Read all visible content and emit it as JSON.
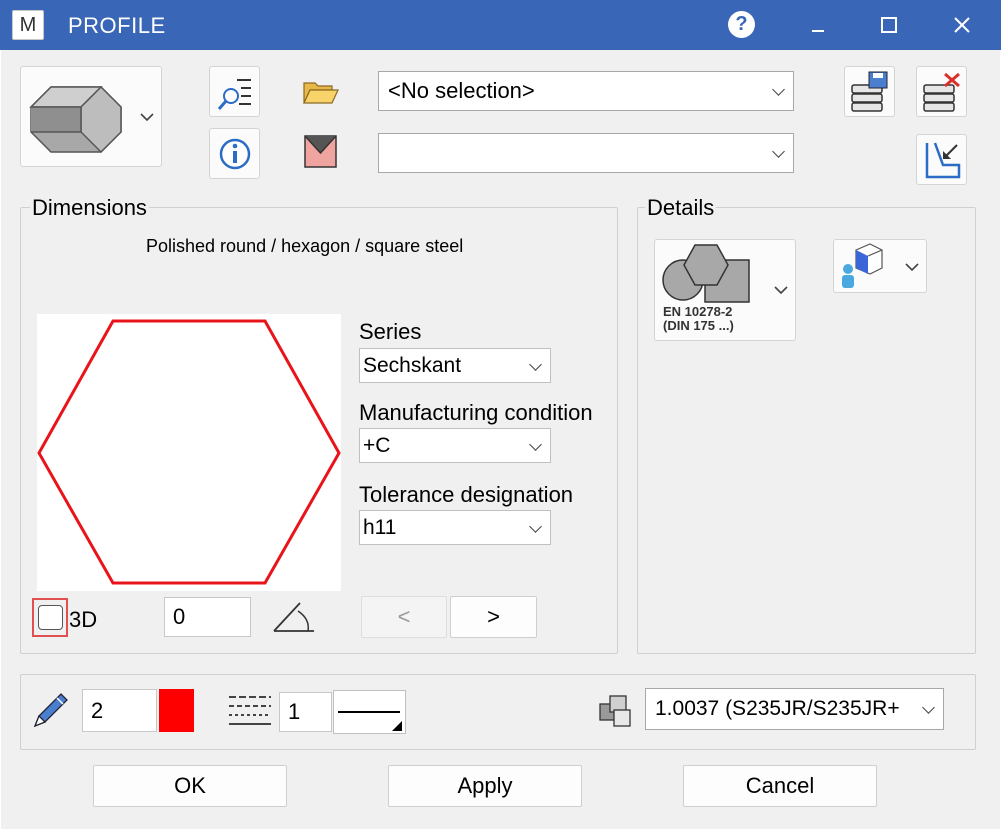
{
  "window": {
    "title": "PROFILE",
    "app_icon_text": "M",
    "help_label": "?",
    "colors": {
      "titlebar": "#3a66b7",
      "accent_red": "#ff0000"
    }
  },
  "top": {
    "selection_value": "<No selection>",
    "second_value": ""
  },
  "dimensions": {
    "group_label": "Dimensions",
    "subtitle": "Polished round / hexagon / square steel",
    "series_label": "Series",
    "series_value": "Sechskant",
    "manufacturing_label": "Manufacturing condition",
    "manufacturing_value": "+C",
    "tolerance_label": "Tolerance designation",
    "tolerance_value": "h11",
    "checkbox_3d_label": "3D",
    "checkbox_3d_checked": false,
    "angle_value": "0",
    "prev_label": "<",
    "next_label": ">"
  },
  "details": {
    "group_label": "Details",
    "standard_line1": "EN 10278-2",
    "standard_line2": "(DIN 175 ...)"
  },
  "bottom": {
    "pen_value": "2",
    "pen_color": "#ff0000",
    "linetype_value": "1",
    "material_value": "1.0037 (S235JR/S235JR+"
  },
  "buttons": {
    "ok": "OK",
    "apply": "Apply",
    "cancel": "Cancel"
  },
  "icons": [
    "app-icon",
    "help-icon",
    "minimize-icon",
    "maximize-icon",
    "close-icon",
    "hexagon-prism-icon",
    "list-search-icon",
    "info-icon",
    "folder-open-icon",
    "envelope-icon",
    "database-save-icon",
    "database-delete-icon",
    "profile-insert-icon",
    "shapes-icon",
    "view-3d-icon",
    "pen-icon",
    "linetype-icon",
    "material-icon",
    "angle-icon",
    "chevron-down-icon"
  ]
}
